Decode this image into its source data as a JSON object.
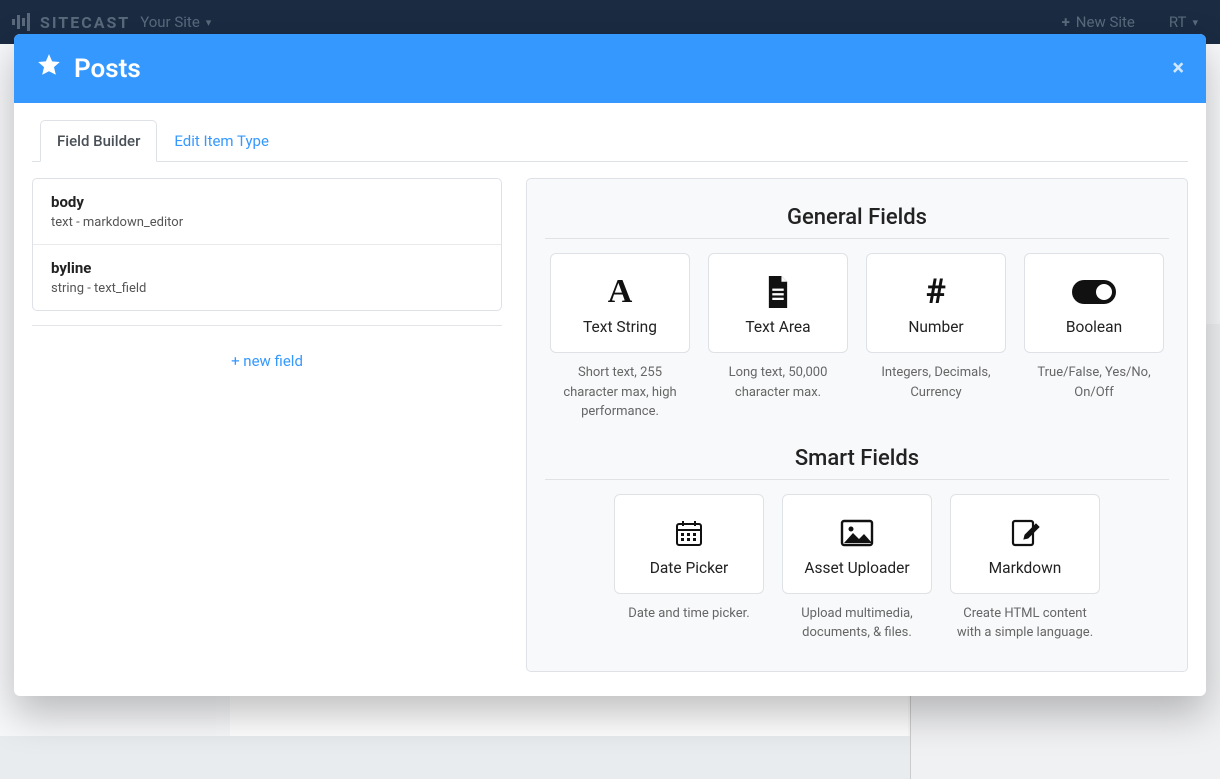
{
  "nav": {
    "brand": "SITECAST",
    "your_site": "Your Site",
    "new_site": "New Site",
    "user_initials": "RT"
  },
  "modal": {
    "title": "Posts"
  },
  "tabs": {
    "field_builder": "Field Builder",
    "edit_item_type": "Edit Item Type"
  },
  "fields": [
    {
      "name": "body",
      "type": "text - markdown_editor"
    },
    {
      "name": "byline",
      "type": "string - text_field"
    }
  ],
  "actions": {
    "add_field": "+ new field"
  },
  "sections": {
    "general": "General Fields",
    "smart": "Smart Fields"
  },
  "field_types": {
    "general": [
      {
        "key": "text_string",
        "label": "Text String",
        "desc": "Short text, 255 character max, high performance."
      },
      {
        "key": "text_area",
        "label": "Text Area",
        "desc": "Long text, 50,000 character max."
      },
      {
        "key": "number",
        "label": "Number",
        "desc": "Integers, Decimals, Currency"
      },
      {
        "key": "boolean",
        "label": "Boolean",
        "desc": "True/False, Yes/No, On/Off"
      }
    ],
    "smart": [
      {
        "key": "date_picker",
        "label": "Date Picker",
        "desc": "Date and time picker."
      },
      {
        "key": "asset_uploader",
        "label": "Asset Uploader",
        "desc": "Upload multimedia, documents, & files."
      },
      {
        "key": "markdown",
        "label": "Markdown",
        "desc": "Create HTML content with a simple language."
      }
    ]
  }
}
